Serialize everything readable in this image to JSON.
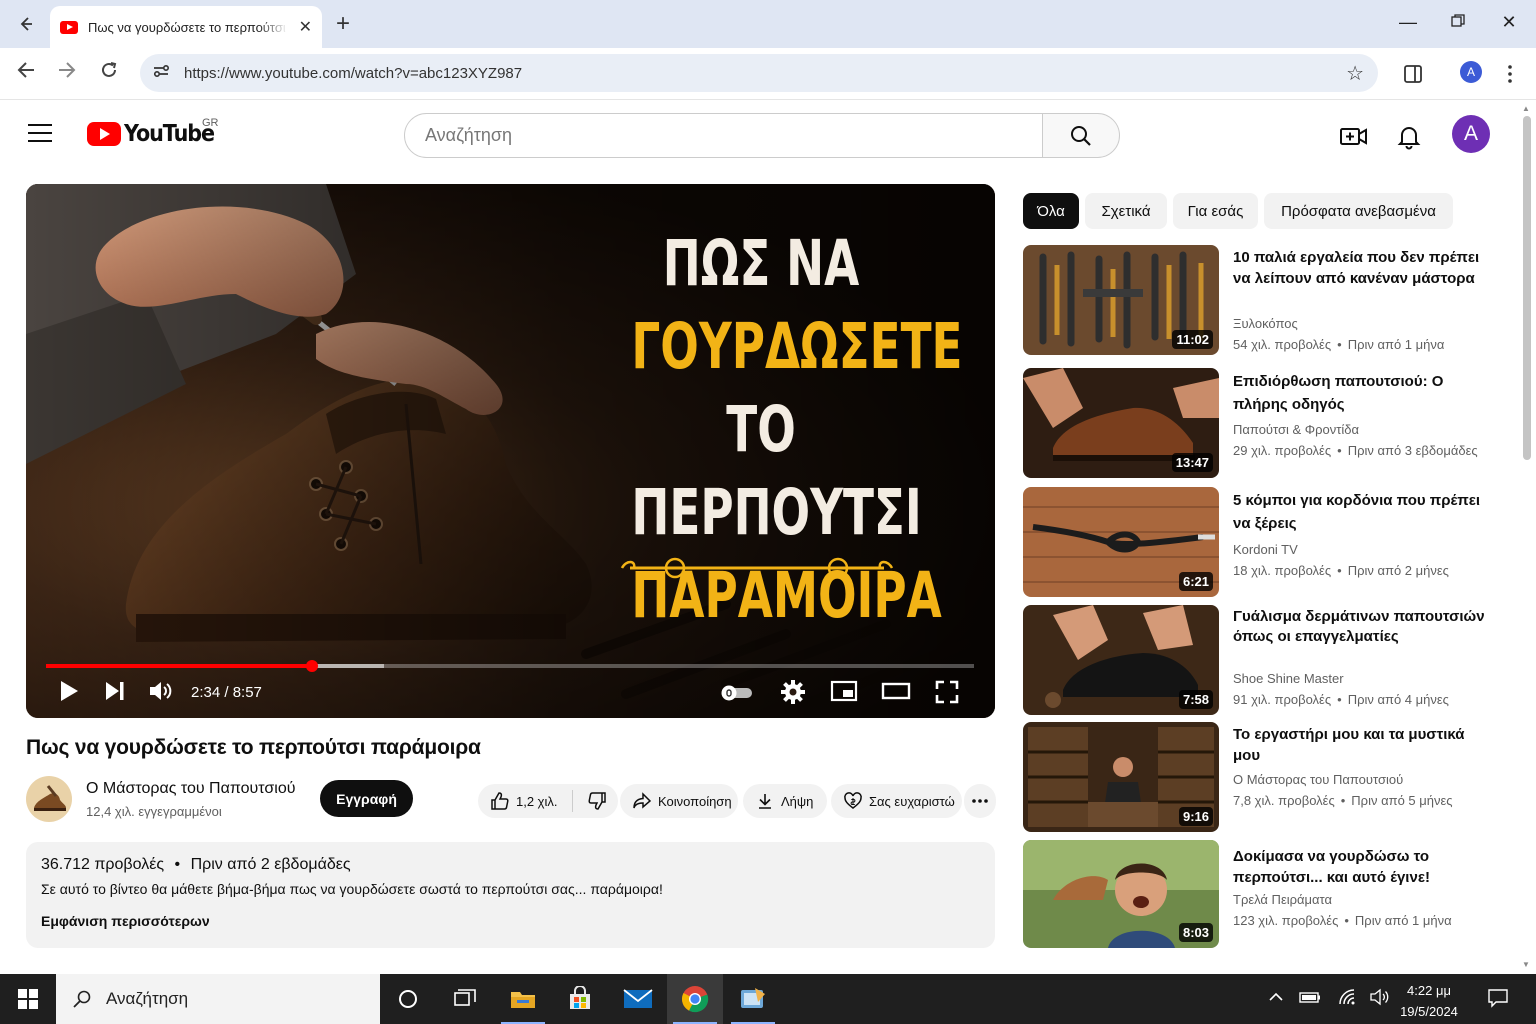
{
  "browser": {
    "tab_title": "Πως να γουρδώσετε το περπούτσι παράμοιρα",
    "url": "https://www.youtube.com/watch?v=abc123XYZ987",
    "profile_letter": "A"
  },
  "header": {
    "logo_text": "YouTube",
    "country_code": "GR",
    "search_placeholder": "Αναζήτηση",
    "avatar_letter": "A"
  },
  "player": {
    "thumbnail_lines": [
      "ΠΩΣ ΝΑ",
      "ΓΟΥΡΔΩΣΕΤΕ",
      "ΤΟ ΠΕΡΠΟΥΤΣΙ",
      "ΠΑΡΑΜΟΙΡΑ"
    ],
    "time_display": "2:34 / 8:57",
    "progress_fraction": 0.287,
    "buffered_fraction": 0.364
  },
  "video": {
    "title": "Πως να γουρδώσετε το περπούτσι παράμοιρα",
    "channel_name": "Ο Μάστορας του Παπουτσιού",
    "subscribers": "12,4 χιλ. εγγεγραμμένοι",
    "subscribe_label": "Εγγραφή",
    "likes": "1,2 χιλ.",
    "share_label": "Κοινοποίηση",
    "download_label": "Λήψη",
    "thanks_label": "Σας ευχαριστώ"
  },
  "description": {
    "views": "36.712 προβολές",
    "date": "Πριν από 2 εβδομάδες",
    "text": "Σε αυτό το βίντεο θα μάθετε βήμα-βήμα πως να γουρδώσετε σωστά το περπούτσι σας... παράμοιρα!",
    "more_label": "Εμφάνιση περισσότερων"
  },
  "chips": [
    "Όλα",
    "Σχετικά",
    "Για εσάς",
    "Πρόσφατα ανεβασμένα"
  ],
  "related": [
    {
      "title": "10 παλιά εργαλεία που δεν πρέπει να λείπουν από κανέναν μάστορα",
      "channel": "Ξυλοκόπος",
      "views": "54 χιλ. προβολές",
      "age": "Πριν από 1 μήνα",
      "duration": "11:02"
    },
    {
      "title": "Επιδιόρθωση παπουτσιού: Ο πλήρης οδηγός",
      "channel": "Παπούτσι & Φροντίδα",
      "views": "29 χιλ. προβολές",
      "age": "Πριν από 3 εβδομάδες",
      "duration": "13:47"
    },
    {
      "title": "5 κόμποι για κορδόνια που πρέπει να ξέρεις",
      "channel": "Kordoni TV",
      "views": "18 χιλ. προβολές",
      "age": "Πριν από 2 μήνες",
      "duration": "6:21"
    },
    {
      "title": "Γυάλισμα δερμάτινων παπουτσιών όπως οι επαγγελματίες",
      "channel": "Shoe Shine Master",
      "views": "91 χιλ. προβολές",
      "age": "Πριν από 4 μήνες",
      "duration": "7:58"
    },
    {
      "title": "Το εργαστήρι μου και τα μυστικά μου",
      "channel": "Ο Μάστορας του Παπουτσιού",
      "views": "7,8 χιλ. προβολές",
      "age": "Πριν από 5 μήνες",
      "duration": "9:16"
    },
    {
      "title": "Δοκίμασα να γουρδώσω το περπούτσι... και αυτό έγινε!",
      "channel": "Τρελά Πειράματα",
      "views": "123 χιλ. προβολές",
      "age": "Πριν από 1 μήνα",
      "duration": "8:03"
    }
  ],
  "taskbar": {
    "search_placeholder": "Αναζήτηση",
    "time": "4:22 μμ",
    "date": "19/5/2024"
  },
  "colors": {
    "yt_red": "#ff0000",
    "gold": "#f2b316",
    "subscribe_bg": "#0f0f0f"
  }
}
